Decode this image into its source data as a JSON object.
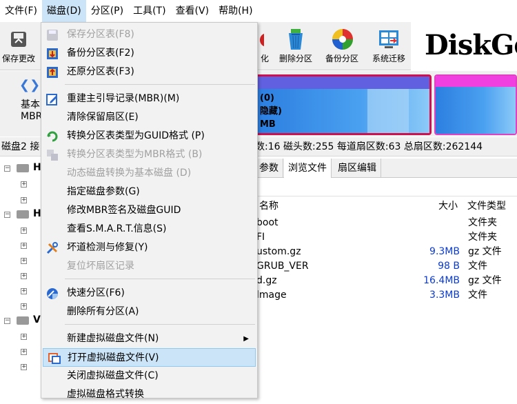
{
  "menubar": {
    "items": [
      "文件(F)",
      "磁盘(D)",
      "分区(P)",
      "工具(T)",
      "查看(V)",
      "帮助(H)"
    ]
  },
  "toolbar": {
    "save_label": "保存更改",
    "partial_label": "化",
    "delete_label": "删除分区",
    "backup_label": "备份分区",
    "migrate_label": "系统迁移",
    "logo": "DiskGen"
  },
  "diskbar": {
    "label1": "基本",
    "label2": "MBR",
    "partition_line1": "(0)",
    "partition_line2": "隐藏)",
    "partition_line3": "MB"
  },
  "infobar": {
    "disk_prefix": "磁盘2 接",
    "geometry": "数:16  磁头数:255  每道扇区数:63  总扇区数:262144"
  },
  "tree": {
    "node1": "H",
    "node2": "H",
    "node3": "V"
  },
  "tabs": [
    "参数",
    "浏览文件",
    "扇区编辑"
  ],
  "file_list": {
    "headers": {
      "name": "名称",
      "size": "大小",
      "type": "文件类型"
    },
    "rows": [
      {
        "name": "boot",
        "size": "",
        "type": "文件夹"
      },
      {
        "name": "FI",
        "size": "",
        "type": "文件夹"
      },
      {
        "name": "ustom.gz",
        "size": "9.3MB",
        "type": "gz 文件"
      },
      {
        "name": "GRUB_VER",
        "size": "98 B",
        "type": "文件"
      },
      {
        "name": "d.gz",
        "size": "16.4MB",
        "type": "gz 文件"
      },
      {
        "name": "lmage",
        "size": "3.3MB",
        "type": "文件"
      }
    ]
  },
  "disk_menu": {
    "items": [
      {
        "label": "保存分区表(F8)",
        "icon": "floppy-save-icon",
        "disabled": true
      },
      {
        "label": "备份分区表(F2)",
        "icon": "backup-table-icon",
        "disabled": false
      },
      {
        "label": "还原分区表(F3)",
        "icon": "restore-table-icon",
        "disabled": false
      },
      {
        "label": "重建主引导记录(MBR)(M)",
        "icon": "edit-mbr-icon",
        "disabled": false
      },
      {
        "label": "清除保留扇区(E)",
        "icon": "",
        "disabled": false
      },
      {
        "label": "转换分区表类型为GUID格式 (P)",
        "icon": "convert-icon",
        "disabled": false
      },
      {
        "label": "转换分区表类型为MBR格式 (B)",
        "icon": "convert-mbr-icon",
        "disabled": true
      },
      {
        "label": "动态磁盘转换为基本磁盘 (D)",
        "icon": "",
        "disabled": true
      },
      {
        "label": "指定磁盘参数(G)",
        "icon": "",
        "disabled": false
      },
      {
        "label": "修改MBR签名及磁盘GUID",
        "icon": "",
        "disabled": false
      },
      {
        "label": "查看S.M.A.R.T.信息(S)",
        "icon": "",
        "disabled": false
      },
      {
        "label": "坏道检测与修复(Y)",
        "icon": "tools-icon",
        "disabled": false
      },
      {
        "label": "复位坏扇区记录",
        "icon": "",
        "disabled": true
      },
      {
        "label": "快速分区(F6)",
        "icon": "quick-partition-icon",
        "disabled": false
      },
      {
        "label": "删除所有分区(A)",
        "icon": "",
        "disabled": false
      },
      {
        "label": "新建虚拟磁盘文件(N)",
        "icon": "",
        "disabled": false,
        "submenu": true
      },
      {
        "label": "打开虚拟磁盘文件(V)",
        "icon": "virtual-disk-icon",
        "disabled": false,
        "highlighted": true
      },
      {
        "label": "关闭虚拟磁盘文件(C)",
        "icon": "",
        "disabled": false
      },
      {
        "label": "虚拟磁盘格式转换",
        "icon": "",
        "disabled": false
      }
    ]
  },
  "colors": {
    "accent": "#cce4f7",
    "partition_border": "#d0104a",
    "size_text": "#0a3ad0"
  }
}
